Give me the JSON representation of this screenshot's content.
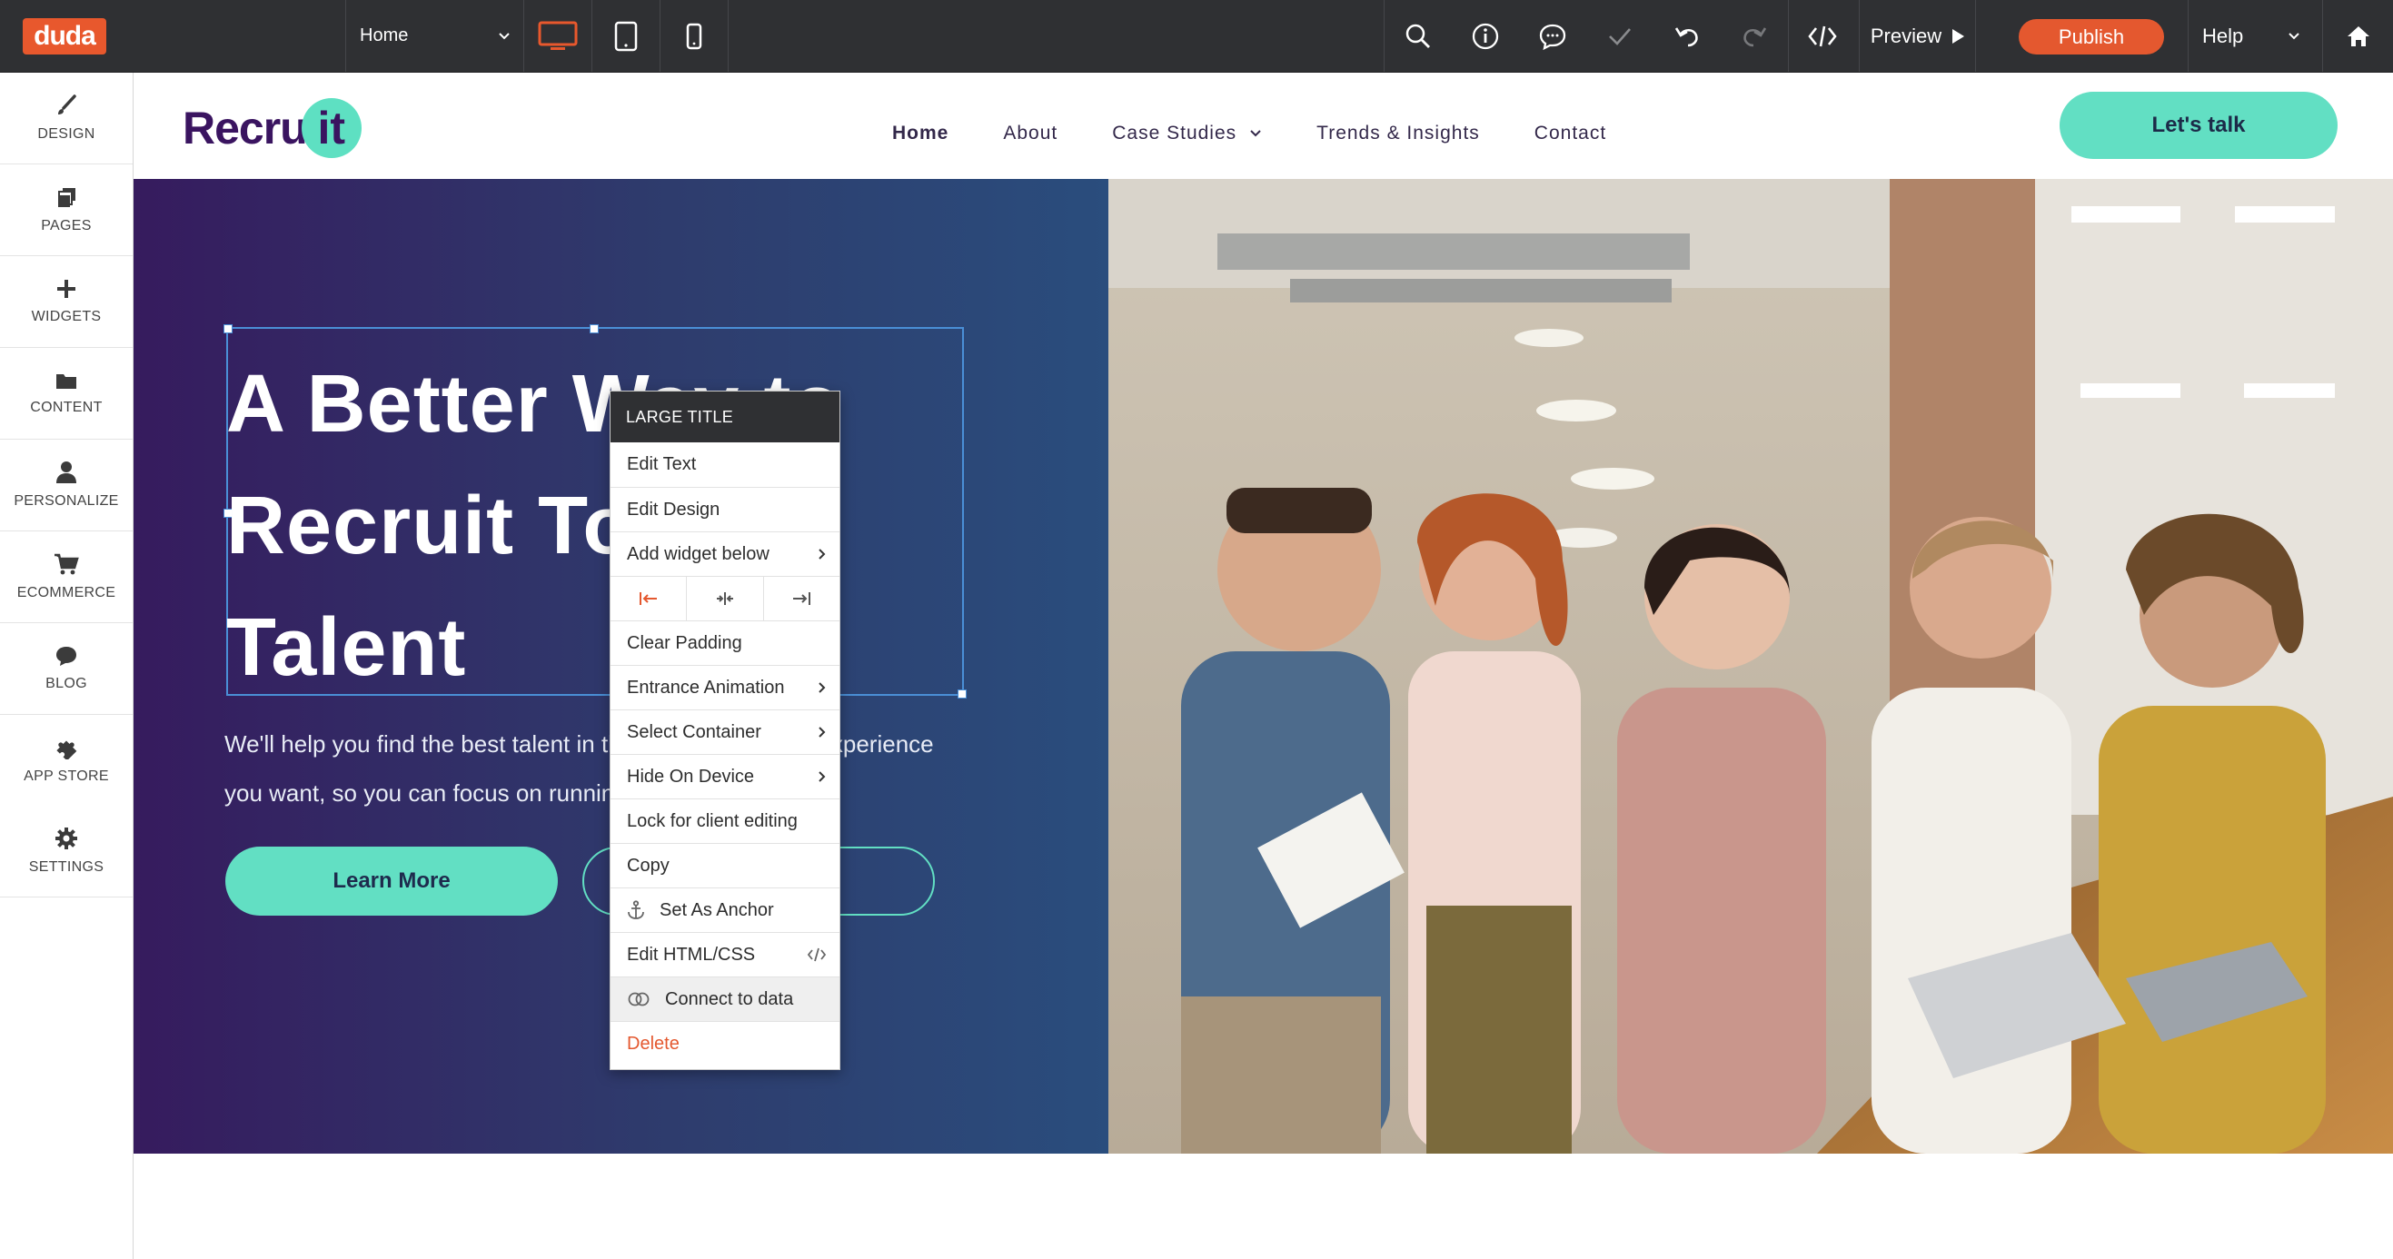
{
  "topbar": {
    "logo": "duda",
    "page_select": "Home",
    "preview_label": "Preview",
    "publish_label": "Publish",
    "help_label": "Help"
  },
  "colors": {
    "topbar_bg": "#2f3033",
    "brand_orange": "#e8582d",
    "accent_teal": "#62dfc3",
    "hero_gradient_start": "#361b5e",
    "hero_gradient_end": "#2a4d7d",
    "selection_blue": "#4a8fd6",
    "delete_red": "#e4582f"
  },
  "sidebar": {
    "items": [
      {
        "label": "DESIGN",
        "icon": "brush-icon"
      },
      {
        "label": "PAGES",
        "icon": "pages-icon"
      },
      {
        "label": "WIDGETS",
        "icon": "plus-icon"
      },
      {
        "label": "CONTENT",
        "icon": "folder-icon"
      },
      {
        "label": "PERSONALIZE",
        "icon": "person-icon"
      },
      {
        "label": "ECOMMERCE",
        "icon": "cart-icon"
      },
      {
        "label": "BLOG",
        "icon": "chat-icon"
      },
      {
        "label": "APP STORE",
        "icon": "puzzle-icon"
      },
      {
        "label": "SETTINGS",
        "icon": "gear-icon"
      }
    ]
  },
  "site": {
    "logo_text": "Recru",
    "logo_badge": "it",
    "nav": [
      "Home",
      "About",
      "Case Studies",
      "Trends & Insights",
      "Contact"
    ],
    "cta": "Let's talk",
    "hero": {
      "title_line1": "A Better Way to",
      "title_line2": "Recruit Top",
      "title_line3": "Talent",
      "subtitle_line1": "We'll help you find the best talent in the industry with the experience",
      "subtitle_line2": "you want, so you can focus on running your business.",
      "primary_button": "Learn More"
    }
  },
  "context_menu": {
    "header": "LARGE TITLE",
    "items": {
      "edit_text": "Edit Text",
      "edit_design": "Edit Design",
      "add_widget_below": "Add widget below",
      "clear_padding": "Clear Padding",
      "entrance_animation": "Entrance Animation",
      "select_container": "Select Container",
      "hide_on_device": "Hide On Device",
      "lock_client_editing": "Lock for client editing",
      "copy": "Copy",
      "set_as_anchor": "Set As Anchor",
      "edit_html_css": "Edit HTML/CSS",
      "connect_to_data": "Connect to data",
      "delete": "Delete"
    }
  }
}
